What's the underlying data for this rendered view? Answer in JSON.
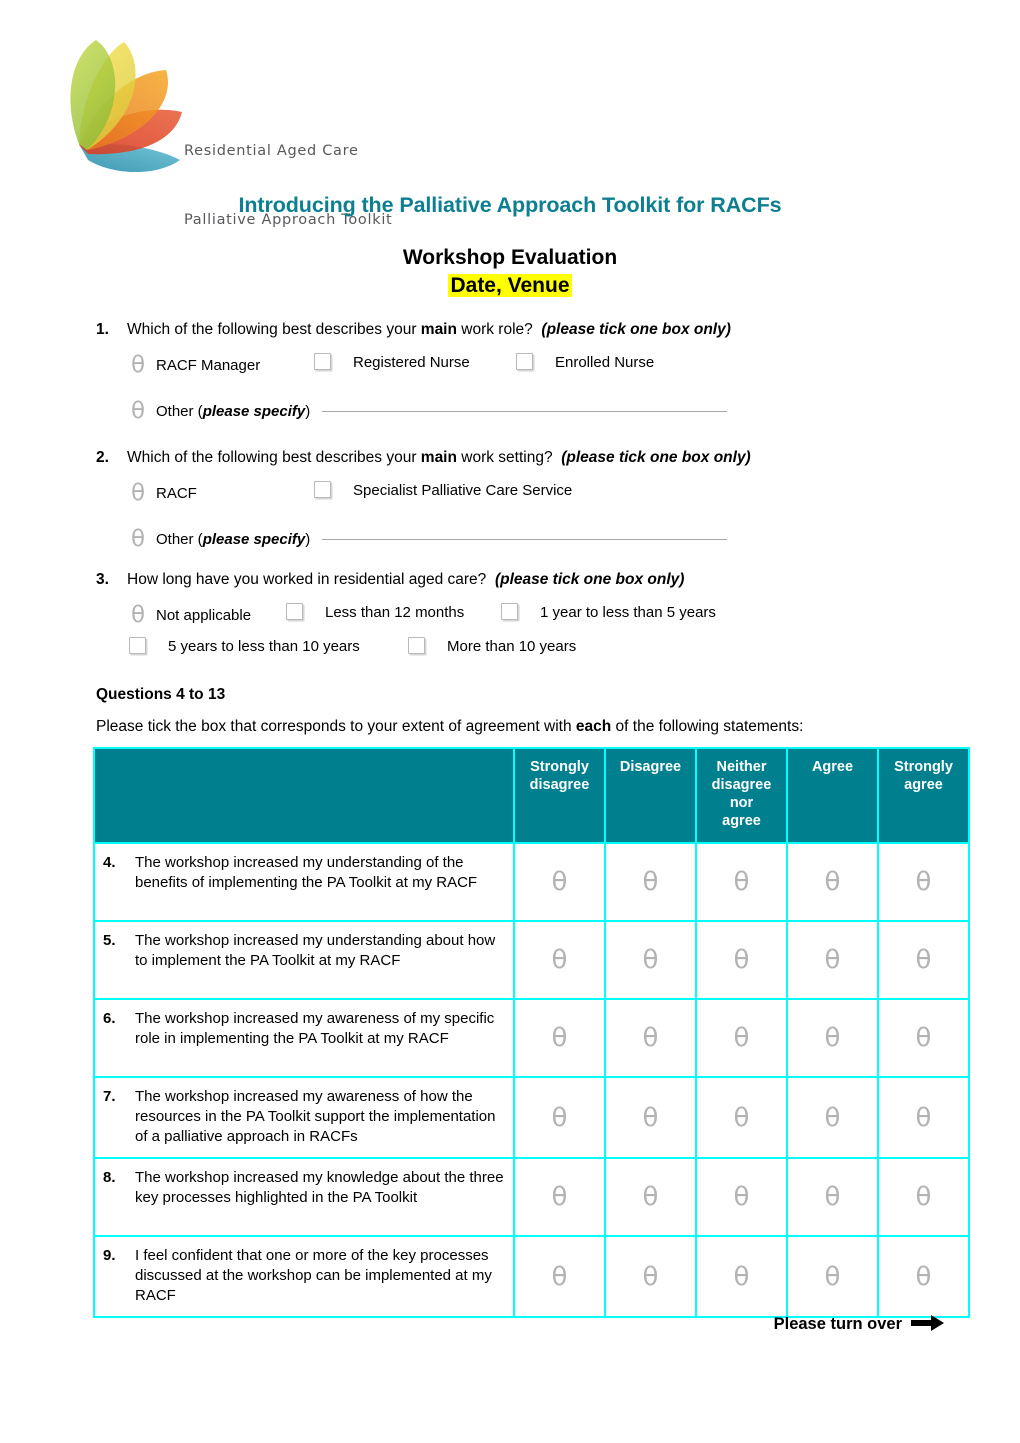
{
  "logo": {
    "line1": "Residential Aged Care",
    "line2": "Palliative Approach Toolkit",
    "colors": {
      "green": "#a6c63c",
      "yellow": "#e8d84a",
      "orange": "#ef8c22",
      "red": "#e0462a",
      "teal": "#3fa9bd"
    }
  },
  "header": {
    "title": "Introducing the Palliative Approach Toolkit for RACFs",
    "subtitle": "Workshop Evaluation",
    "venue": "Date, Venue",
    "title_color": "#0d7f91",
    "highlight_color": "#ffff00"
  },
  "questions": [
    {
      "number": "1.",
      "text_before": "Which of the following best describes your ",
      "text_bold": "main",
      "text_after": " work role?",
      "hint": "(please tick one box only)",
      "options": [
        {
          "label": "RACF Manager",
          "glyph": "theta"
        },
        {
          "label": "Registered Nurse",
          "glyph": "square"
        },
        {
          "label": "Enrolled Nurse",
          "glyph": "square"
        }
      ],
      "specify": {
        "glyph": "theta",
        "label_plain": "Other (",
        "label_italic": "please specify",
        "label_close": ")"
      }
    },
    {
      "number": "2.",
      "text_before": "Which of the following best describes your ",
      "text_bold": "main",
      "text_after": " work setting?",
      "hint": "(please tick one box only)",
      "options": [
        {
          "label": "RACF",
          "glyph": "theta"
        },
        {
          "label": "Specialist Palliative Care Service",
          "glyph": "square"
        }
      ],
      "specify": {
        "glyph": "theta",
        "label_plain": "Other (",
        "label_italic": "please specify",
        "label_close": ")"
      }
    },
    {
      "number": "3.",
      "text_before": "How long have you worked in residential aged care?",
      "text_bold": "",
      "text_after": "",
      "hint": "(please tick one box only)",
      "options_row1": [
        {
          "label": "Not applicable",
          "glyph": "theta"
        },
        {
          "label": "Less than 12 months",
          "glyph": "square"
        },
        {
          "label": "1 year to less than 5 years",
          "glyph": "square"
        }
      ],
      "options_row2": [
        {
          "label": "5 years to less than 10 years",
          "glyph": "square"
        },
        {
          "label": "More than 10 years",
          "glyph": "square"
        }
      ]
    }
  ],
  "section": {
    "heading": "Questions 4 to 13",
    "intro_before": "Please tick the box that corresponds to your extent of agreement with ",
    "intro_bold": "each",
    "intro_after": " of the following statements:"
  },
  "table": {
    "header_bg": "#00808f",
    "border_color": "#00ffff",
    "columns": [
      "",
      "Strongly disagree",
      "Disagree",
      "Neither disagree nor agree",
      "Agree",
      "Strongly agree"
    ],
    "column_lines": [
      [
        ""
      ],
      [
        "Strongly",
        "disagree"
      ],
      [
        "Disagree"
      ],
      [
        "Neither",
        "disagree",
        "nor",
        "agree"
      ],
      [
        "Agree"
      ],
      [
        "Strongly",
        "agree"
      ]
    ],
    "rows": [
      {
        "number": "4.",
        "statement": "The workshop increased my understanding of the benefits of implementing the PA Toolkit at my RACF",
        "cells": [
          "theta",
          "theta",
          "theta",
          "theta",
          "theta"
        ]
      },
      {
        "number": "5.",
        "statement": "The workshop increased my understanding about how to implement the PA Toolkit at my RACF",
        "cells": [
          "theta",
          "theta",
          "theta",
          "theta",
          "theta"
        ]
      },
      {
        "number": "6.",
        "statement": "The workshop increased my awareness of my specific role in implementing the PA Toolkit at my RACF",
        "cells": [
          "theta",
          "theta",
          "theta",
          "theta",
          "theta"
        ]
      },
      {
        "number": "7.",
        "statement": "The workshop increased my awareness of how the resources in the PA Toolkit support the implementation of a palliative approach in RACFs",
        "cells": [
          "theta",
          "theta",
          "theta",
          "theta",
          "theta"
        ]
      },
      {
        "number": "8.",
        "statement": "The workshop increased my knowledge about the three key processes highlighted in the PA Toolkit",
        "cells": [
          "theta",
          "theta",
          "theta",
          "theta",
          "theta"
        ]
      },
      {
        "number": "9.",
        "statement": "I feel confident that one or more of the key processes discussed at the workshop can be implemented at my RACF",
        "cells": [
          "theta",
          "theta",
          "theta",
          "theta",
          "theta"
        ]
      }
    ]
  },
  "footer": {
    "turn_over": "Please turn over"
  }
}
